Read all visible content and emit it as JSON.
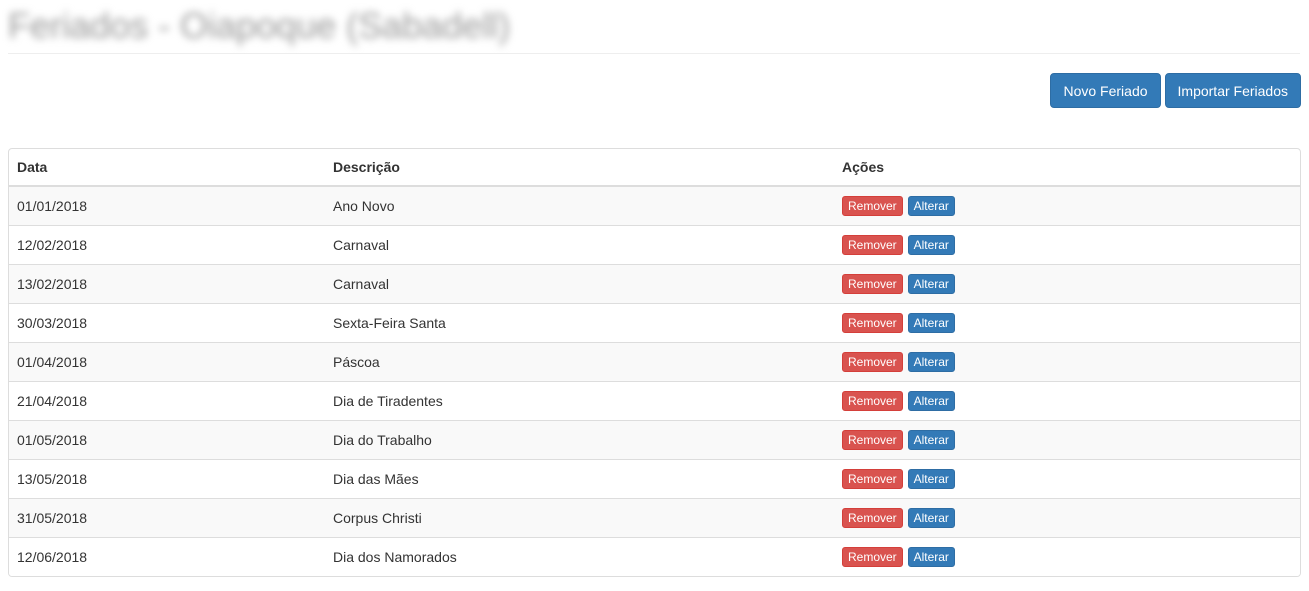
{
  "header": {
    "title": "Feriados - Oiapoque (Sabadell)"
  },
  "toolbar": {
    "new_label": "Novo Feriado",
    "import_label": "Importar Feriados"
  },
  "table": {
    "columns": [
      "Data",
      "Descrição",
      "Ações"
    ],
    "remove_label": "Remover",
    "edit_label": "Alterar",
    "rows": [
      {
        "date": "01/01/2018",
        "description": "Ano Novo"
      },
      {
        "date": "12/02/2018",
        "description": "Carnaval"
      },
      {
        "date": "13/02/2018",
        "description": "Carnaval"
      },
      {
        "date": "30/03/2018",
        "description": "Sexta-Feira Santa"
      },
      {
        "date": "01/04/2018",
        "description": "Páscoa"
      },
      {
        "date": "21/04/2018",
        "description": "Dia de Tiradentes"
      },
      {
        "date": "01/05/2018",
        "description": "Dia do Trabalho"
      },
      {
        "date": "13/05/2018",
        "description": "Dia das Mães"
      },
      {
        "date": "31/05/2018",
        "description": "Corpus Christi"
      },
      {
        "date": "12/06/2018",
        "description": "Dia dos Namorados"
      }
    ]
  },
  "colors": {
    "primary": "#337ab7",
    "danger": "#d9534f",
    "stripe": "#f9f9f9",
    "border": "#dddddd"
  }
}
